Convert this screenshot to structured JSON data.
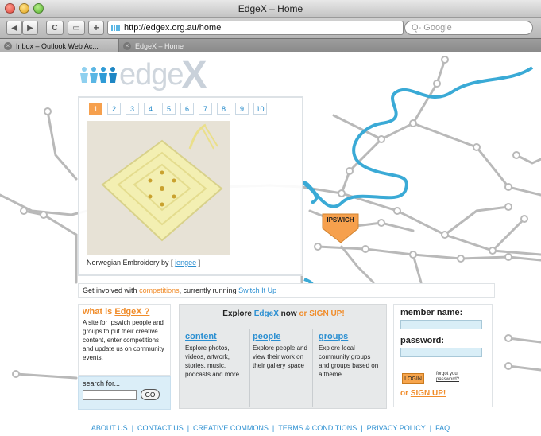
{
  "window": {
    "title": "EdgeX – Home"
  },
  "toolbar": {
    "url": "http://edgex.org.au/home",
    "search_placeholder": "Q- Google",
    "back_icon": "back-arrow",
    "forward_icon": "forward-arrow",
    "reload_icon": "reload",
    "bookmark_icon": "bookmark-window",
    "add_icon": "plus"
  },
  "tabs": [
    {
      "label": "Inbox – Outlook Web Ac..."
    },
    {
      "label": "EdgeX – Home"
    }
  ],
  "logo": {
    "text": "edge",
    "suffix": "X"
  },
  "map": {
    "marker_label": "IPSWICH",
    "marker_color": "#f6a04d",
    "river_color": "#3aaad6",
    "road_color": "#b9b9b9"
  },
  "gallery": {
    "pages": [
      "1",
      "2",
      "3",
      "4",
      "5",
      "6",
      "7",
      "8",
      "9",
      "10"
    ],
    "active_page": "1",
    "caption_prefix": "Norwegian Embroidery by [",
    "caption_user": "jengee",
    "caption_suffix": "]"
  },
  "strip": {
    "prefix": "Get involved with",
    "competitions": "competitions",
    "middle": ", currently running",
    "current": "Switch It Up"
  },
  "what": {
    "prefix": "what is",
    "brand": "EdgeX ?",
    "text": "A site for Ipswich people and groups to put their creative content, enter competitions and update us on community events."
  },
  "searchbox": {
    "label": "search for...",
    "go": "GO"
  },
  "explore": {
    "prefix": "Explore",
    "brand": "EdgeX",
    "middle": "now",
    "or": "or",
    "signup": "SIGN UP!",
    "columns": [
      {
        "title": "content",
        "text": "Explore photos, videos, artwork, stories, music, podcasts and more"
      },
      {
        "title": "people",
        "text": "Explore people and view their work on their gallery space"
      },
      {
        "title": "groups",
        "text": "Explore local community groups and groups based on a theme"
      }
    ]
  },
  "login": {
    "member_label": "member name:",
    "password_label": "password:",
    "login_button": "LOGIN",
    "forgot_line1": "forgot your",
    "forgot_line2": "password?",
    "or": "or",
    "signup": "SIGN UP!"
  },
  "footer": {
    "links": [
      "ABOUT US",
      "CONTACT US",
      "CREATIVE COMMONS",
      "TERMS & CONDITIONS",
      "PRIVACY POLICY",
      "FAQ"
    ]
  }
}
